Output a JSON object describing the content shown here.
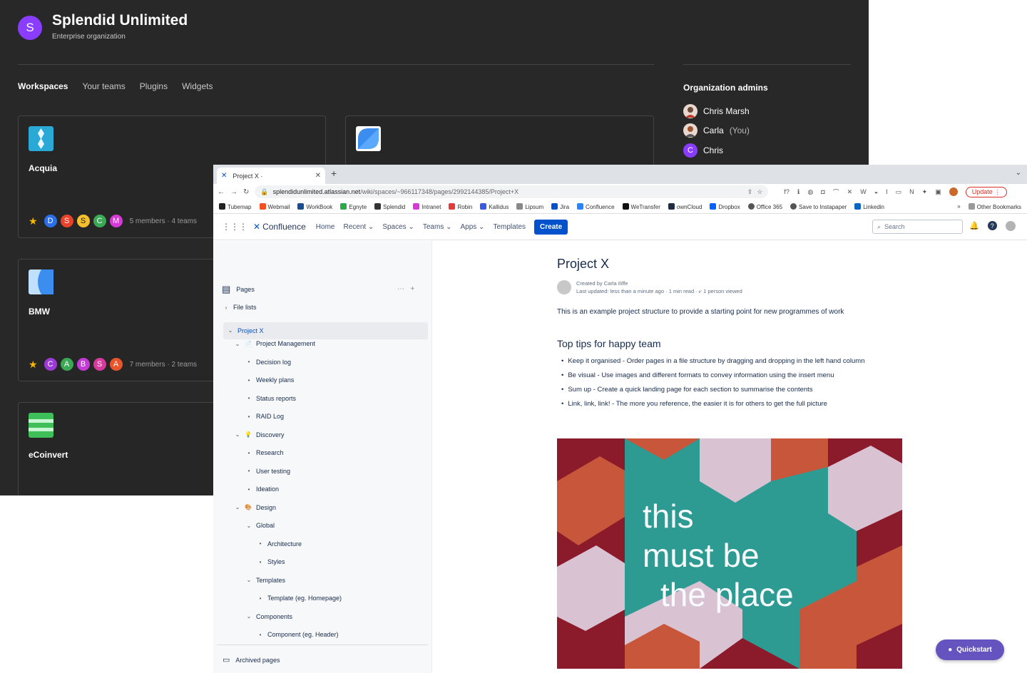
{
  "org": {
    "avatar_letter": "S",
    "name": "Splendid Unlimited",
    "subtitle": "Enterprise organization",
    "tabs": [
      "Workspaces",
      "Your teams",
      "Plugins",
      "Widgets"
    ],
    "workspaces": [
      {
        "name": "Acquia",
        "members": [
          "D",
          "S",
          "S",
          "C",
          "M"
        ],
        "meta": "5 members · 4 teams"
      },
      {
        "name": "BMW",
        "members": [
          "C",
          "A",
          "B",
          "S",
          "A"
        ],
        "meta": "7 members · 2 teams"
      },
      {
        "name": "eCoinvert",
        "members": [],
        "meta": ""
      }
    ],
    "admins_title": "Organization admins",
    "admins": [
      {
        "name": "Chris Marsh",
        "suffix": ""
      },
      {
        "name": "Carla",
        "suffix": "(You)"
      },
      {
        "name": "Chris",
        "suffix": "",
        "letter": "C"
      }
    ]
  },
  "browser": {
    "tab_title": "Project X ·",
    "url_host": "splendidunlimited.atlassian.net",
    "url_path": "/wiki/spaces/~966117348/pages/2992144385/Project+X",
    "update_label": "Update",
    "bookmarks": [
      "Tubemap",
      "Webmail",
      "WorkBook",
      "Egnyte",
      "Splendid",
      "Intranet",
      "Robin",
      "Kallidus",
      "Lipsum",
      "Jira",
      "Confluence",
      "WeTransfer",
      "ownCloud",
      "Dropbox",
      "Office 365",
      "Save to Instapaper",
      "Linkedin"
    ],
    "other_bookmarks": "Other Bookmarks"
  },
  "confluence": {
    "product": "Confluence",
    "nav": [
      "Home",
      "Recent",
      "Spaces",
      "Teams",
      "Apps",
      "Templates"
    ],
    "create_label": "Create",
    "search_placeholder": "Search"
  },
  "sidebar": {
    "heading": "Pages",
    "archived": "Archived pages",
    "tree": [
      {
        "label": "File lists",
        "level": 0,
        "kind": "collapsed"
      },
      {
        "label": "Project X",
        "level": 0,
        "kind": "expanded",
        "selected": true
      },
      {
        "label": "Project Management",
        "level": 1,
        "kind": "expanded",
        "emoji": "📄"
      },
      {
        "label": "Decision log",
        "level": 2,
        "kind": "bullet"
      },
      {
        "label": "Weekly plans",
        "level": 2,
        "kind": "bullet"
      },
      {
        "label": "Status reports",
        "level": 2,
        "kind": "bullet"
      },
      {
        "label": "RAID Log",
        "level": 2,
        "kind": "bullet"
      },
      {
        "label": "Discovery",
        "level": 1,
        "kind": "expanded",
        "emoji": "💡"
      },
      {
        "label": "Research",
        "level": 2,
        "kind": "bullet"
      },
      {
        "label": "User testing",
        "level": 2,
        "kind": "bullet"
      },
      {
        "label": "Ideation",
        "level": 2,
        "kind": "bullet"
      },
      {
        "label": "Design",
        "level": 1,
        "kind": "expanded",
        "emoji": "🎨"
      },
      {
        "label": "Global",
        "level": 2,
        "kind": "expanded"
      },
      {
        "label": "Architecture",
        "level": 3,
        "kind": "bullet"
      },
      {
        "label": "Styles",
        "level": 3,
        "kind": "bullet"
      },
      {
        "label": "Templates",
        "level": 2,
        "kind": "expanded"
      },
      {
        "label": "Template (eg. Homepage)",
        "level": 3,
        "kind": "bullet"
      },
      {
        "label": "Components",
        "level": 2,
        "kind": "expanded"
      },
      {
        "label": "Component (eg. Header)",
        "level": 3,
        "kind": "bullet"
      }
    ]
  },
  "page": {
    "title": "Project X",
    "created_by": "Created by Carla Iliffe",
    "last_updated": "Last updated: less than a minute ago",
    "read_time": "1 min read",
    "viewed": "1 person viewed",
    "intro": "This is an example project structure to provide a starting point for new programmes of work",
    "tips_heading": "Top tips for happy team",
    "tips": [
      "Keep it organised - Order pages in a file structure by dragging and dropping in the left hand column",
      "Be visual - Use images and different formats to convey information using the insert menu",
      "Sum up - Create a quick landing page for each section to summarise the contents",
      "Link, link, link! - The more you reference, the easier it is for others to get the full picture"
    ],
    "neon_lines": [
      "this",
      "must be",
      "the place"
    ]
  },
  "quickstart": "Quickstart"
}
